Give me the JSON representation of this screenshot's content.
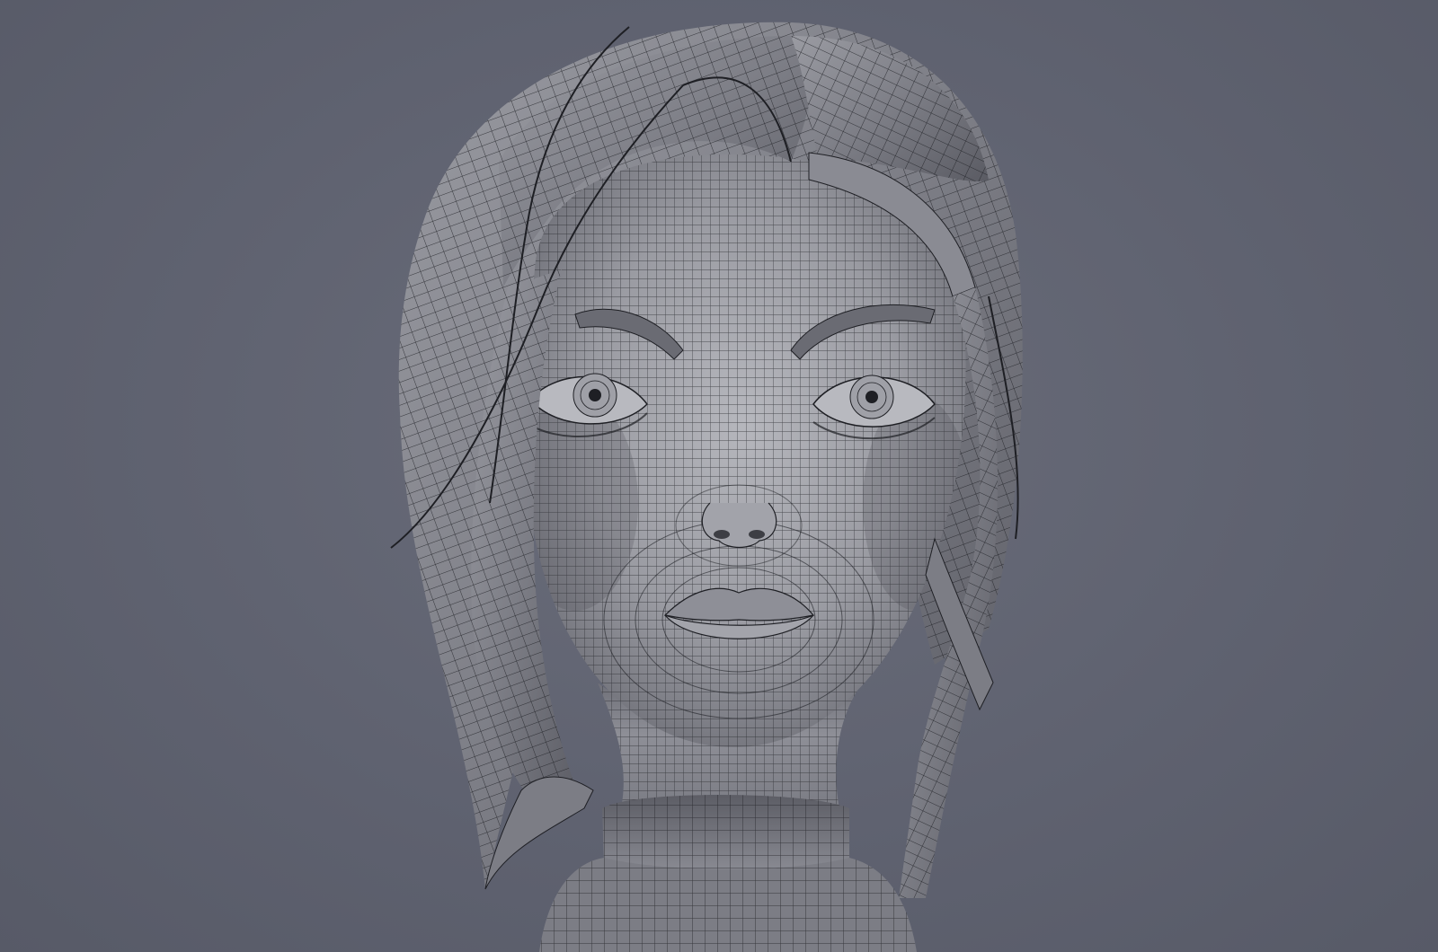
{
  "scene": {
    "subject_icon": "wireframe-head-icon",
    "colors": {
      "background": "#5f6270",
      "surface": "#8a8c95",
      "surface_light": "#b3b4ba",
      "surface_dark": "#4a4b52",
      "wire": "#1e1f24"
    }
  }
}
